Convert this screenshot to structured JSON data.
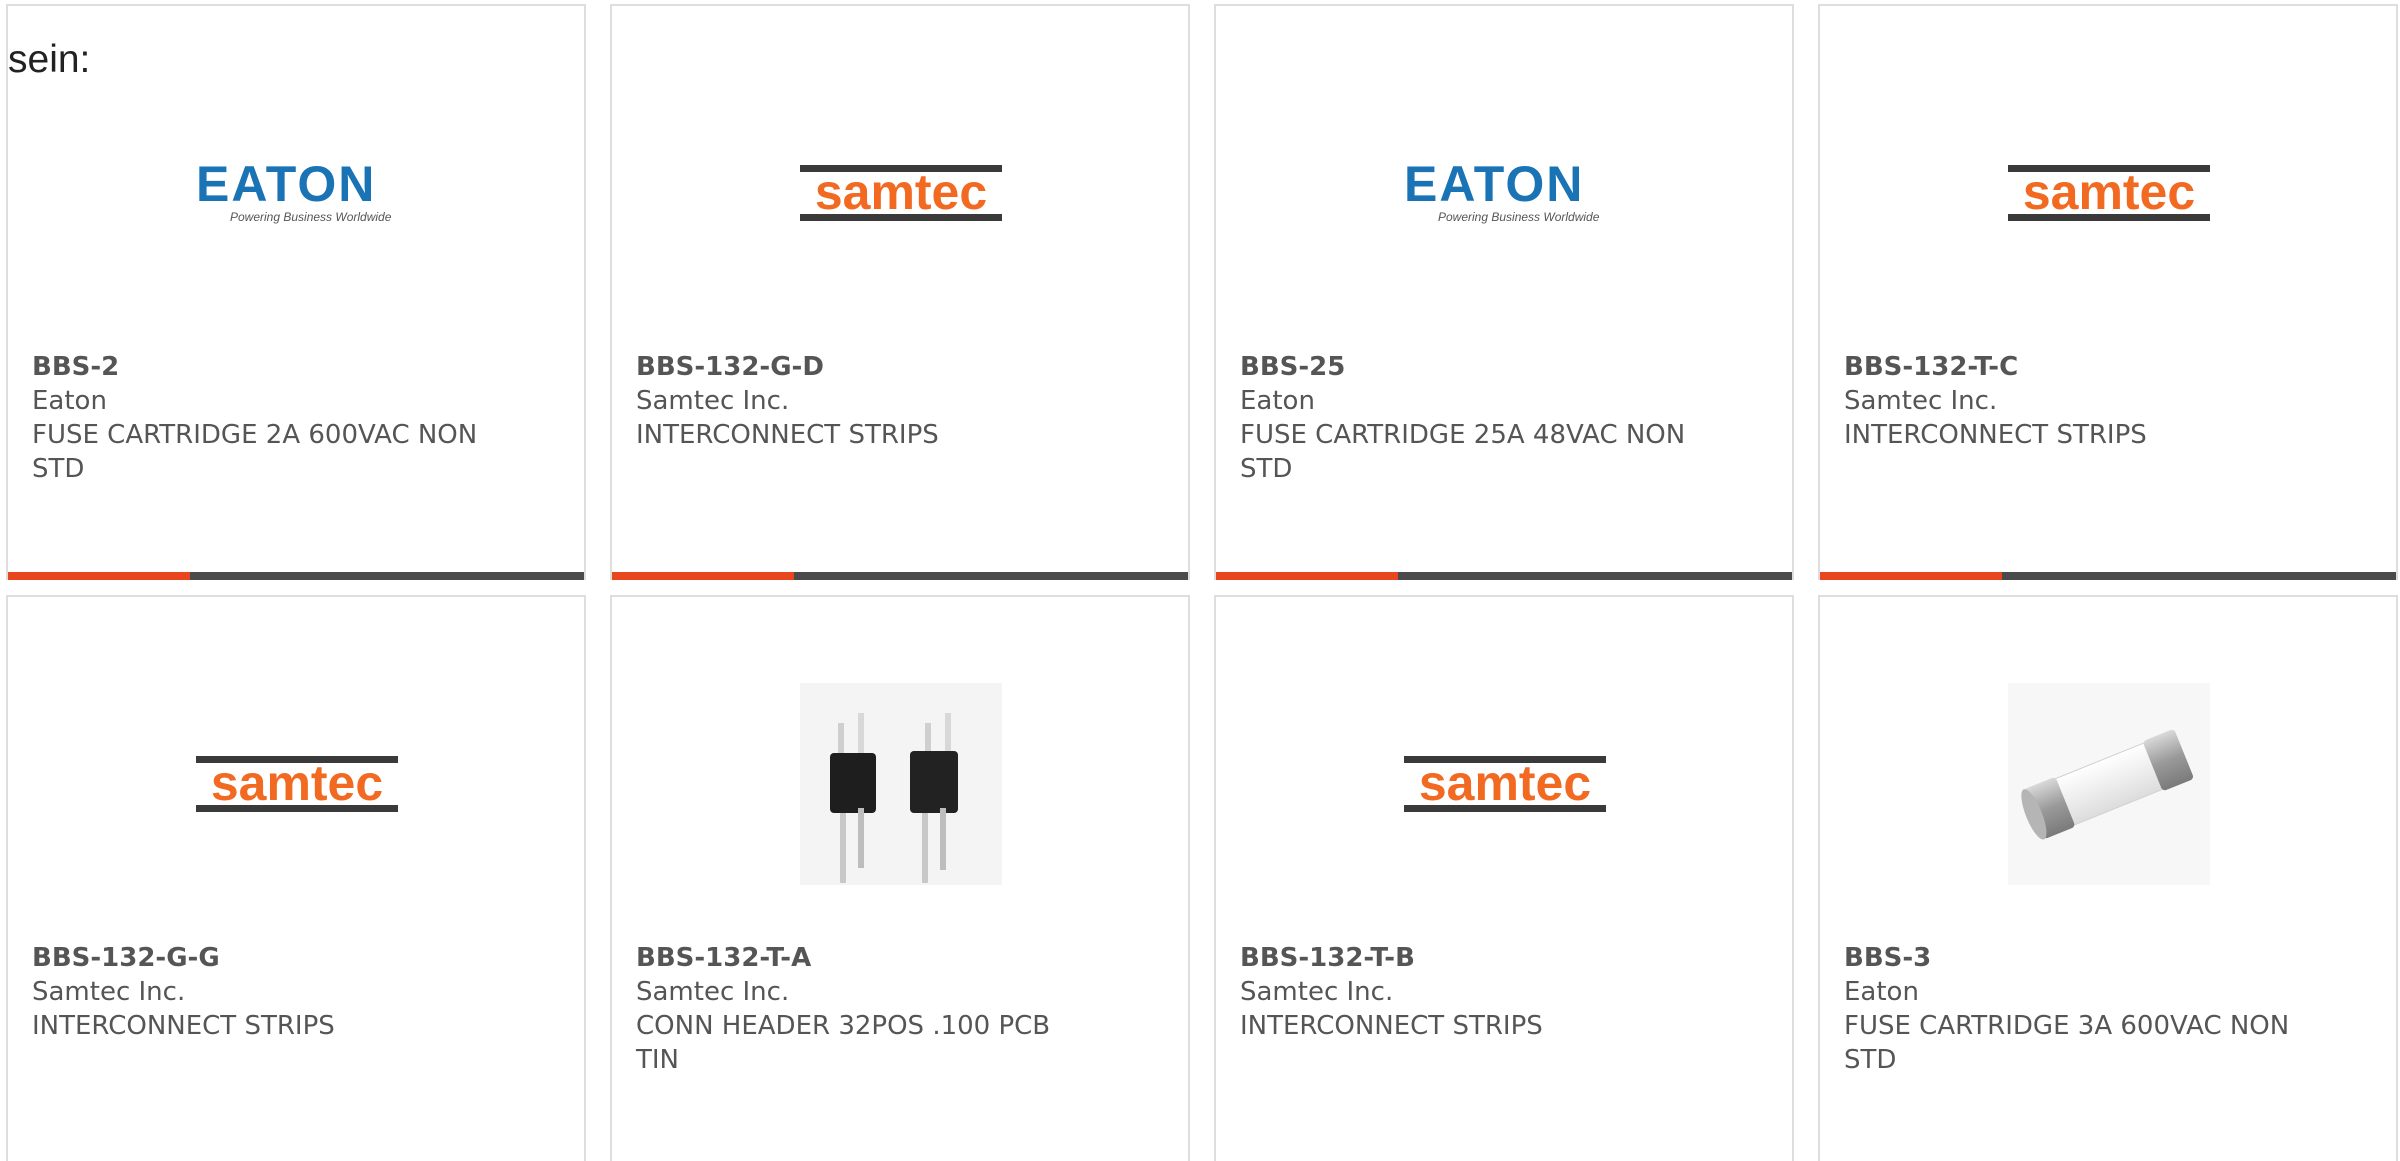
{
  "intro_text": "sein:",
  "colors": {
    "accent": "#e8461e",
    "bar_rest": "#4a4a4a",
    "eaton_blue": "#1a73b5",
    "samtec_orange": "#f26a21"
  },
  "products": [
    {
      "part": "BBS-2",
      "manufacturer": "Eaton",
      "description": "FUSE CARTRIDGE 2A 600VAC NON STD",
      "image": "eaton-logo"
    },
    {
      "part": "BBS-132-G-D",
      "manufacturer": "Samtec Inc.",
      "description": "INTERCONNECT STRIPS",
      "image": "samtec-logo"
    },
    {
      "part": "BBS-25",
      "manufacturer": "Eaton",
      "description": "FUSE CARTRIDGE 25A 48VAC NON STD",
      "image": "eaton-logo"
    },
    {
      "part": "BBS-132-T-C",
      "manufacturer": "Samtec Inc.",
      "description": "INTERCONNECT STRIPS",
      "image": "samtec-logo"
    },
    {
      "part": "BBS-132-G-G",
      "manufacturer": "Samtec Inc.",
      "description": "INTERCONNECT STRIPS",
      "image": "samtec-logo"
    },
    {
      "part": "BBS-132-T-A",
      "manufacturer": "Samtec Inc.",
      "description": "CONN HEADER 32POS .100 PCB TIN",
      "image": "connector-header-photo"
    },
    {
      "part": "BBS-132-T-B",
      "manufacturer": "Samtec Inc.",
      "description": "INTERCONNECT STRIPS",
      "image": "samtec-logo"
    },
    {
      "part": "BBS-3",
      "manufacturer": "Eaton",
      "description": "FUSE CARTRIDGE 3A 600VAC NON STD",
      "image": "fuse-cartridge-photo"
    }
  ],
  "logos": {
    "eaton": {
      "wordmark": "EATON",
      "tagline": "Powering Business Worldwide"
    },
    "samtec": {
      "wordmark": "samtec"
    }
  }
}
